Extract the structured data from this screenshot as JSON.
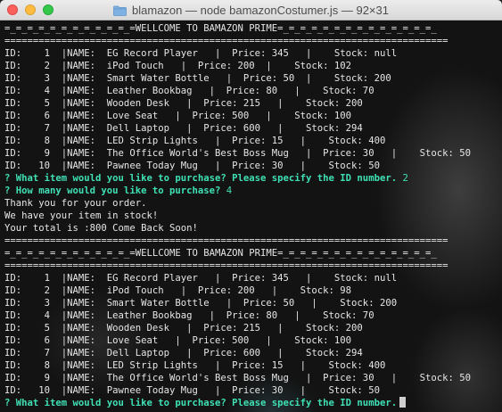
{
  "window": {
    "title": "blamazon — node bamazonCostumer.js — 92×31"
  },
  "terminal": {
    "lines": [
      {
        "text": "=_=_=_=_=_=_=_=_=_=_=_=WELLCOME TO BAMAZON PRIME=_=_=_=_=_=_=_=_=_=_=_=_=_=_",
        "kind": "out"
      },
      {
        "text": "==============================================================================",
        "kind": "out"
      },
      {
        "text": "ID:    1  |NAME:  EG Record Player   |  Price: 345   |    Stock: null",
        "kind": "out"
      },
      {
        "text": "ID:    2  |NAME:  iPod Touch   |  Price: 200  |    Stock: 102",
        "kind": "out"
      },
      {
        "text": "ID:    3  |NAME:  Smart Water Bottle   |  Price: 50  |    Stock: 200",
        "kind": "out"
      },
      {
        "text": "ID:    4  |NAME:  Leather Bookbag   |  Price: 80   |    Stock: 70",
        "kind": "out"
      },
      {
        "text": "ID:    5  |NAME:  Wooden Desk   |  Price: 215   |    Stock: 200",
        "kind": "out"
      },
      {
        "text": "ID:    6  |NAME:  Love Seat   |  Price: 500   |    Stock: 100",
        "kind": "out"
      },
      {
        "text": "ID:    7  |NAME:  Dell Laptop   |  Price: 600   |    Stock: 294",
        "kind": "out"
      },
      {
        "text": "ID:    8  |NAME:  LED Strip Lights   |  Price: 15   |    Stock: 400",
        "kind": "out"
      },
      {
        "text": "ID:    9  |NAME:  The Office World's Best Boss Mug   |  Price: 30   |    Stock: 50",
        "kind": "out"
      },
      {
        "text": "ID:   10  |NAME:  Pawnee Today Mug   |  Price: 30   |    Stock: 50",
        "kind": "out"
      },
      {
        "text": "? What item would you like to purchase? Please specify the ID number.",
        "kind": "prompt",
        "answer": "2"
      },
      {
        "text": "? How many would you like to purchase?",
        "kind": "prompt",
        "answer": "4"
      },
      {
        "text": "Thank you for your order.",
        "kind": "out"
      },
      {
        "text": "We have your item in stock!",
        "kind": "out"
      },
      {
        "text": "Your total is :800 Come Back Soon!",
        "kind": "out"
      },
      {
        "text": "==============================================================================",
        "kind": "out"
      },
      {
        "text": "=_=_=_=_=_=_=_=_=_=_=_=WELLCOME TO BAMAZON PRIME=_=_=_=_=_=_=_=_=_=_=_=_=_=_",
        "kind": "out"
      },
      {
        "text": "==============================================================================",
        "kind": "out"
      },
      {
        "text": "ID:    1  |NAME:  EG Record Player   |  Price: 345   |    Stock: null",
        "kind": "out"
      },
      {
        "text": "ID:    2  |NAME:  iPod Touch   |  Price: 200   |    Stock: 98",
        "kind": "out"
      },
      {
        "text": "ID:    3  |NAME:  Smart Water Bottle   |  Price: 50   |    Stock: 200",
        "kind": "out"
      },
      {
        "text": "ID:    4  |NAME:  Leather Bookbag   |  Price: 80   |    Stock: 70",
        "kind": "out"
      },
      {
        "text": "ID:    5  |NAME:  Wooden Desk   |  Price: 215   |    Stock: 200",
        "kind": "out"
      },
      {
        "text": "ID:    6  |NAME:  Love Seat   |  Price: 500   |    Stock: 100",
        "kind": "out"
      },
      {
        "text": "ID:    7  |NAME:  Dell Laptop   |  Price: 600   |    Stock: 294",
        "kind": "out"
      },
      {
        "text": "ID:    8  |NAME:  LED Strip Lights   |  Price: 15   |    Stock: 400",
        "kind": "out"
      },
      {
        "text": "ID:    9  |NAME:  The Office World's Best Boss Mug   |  Price: 30   |    Stock: 50",
        "kind": "out"
      },
      {
        "text": "ID:   10  |NAME:  Pawnee Today Mug   |  Price: 30   |    Stock: 50",
        "kind": "out"
      },
      {
        "text": "? What item would you like to purchase? Please specify the ID number.",
        "kind": "prompt",
        "answer": ""
      }
    ]
  },
  "colors": {
    "prompt": "#3fe0b5",
    "text": "#e6e6e6",
    "background": "#131313"
  },
  "icons": {
    "folder": "folder-icon"
  }
}
